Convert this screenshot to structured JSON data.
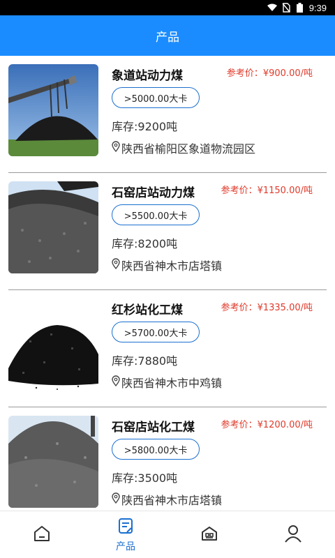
{
  "status": {
    "time": "9:39"
  },
  "header": {
    "title": "产品"
  },
  "products": [
    {
      "name": "象道站动力煤",
      "price": "参考价：¥900.00/吨",
      "calorific": ">5000.00大卡",
      "stock": "库存:9200吨",
      "location": "陕西省榆阳区象道物流园区",
      "image": "coal-conveyor-photo"
    },
    {
      "name": "石窑店站动力煤",
      "price": "参考价：¥1150.00/吨",
      "calorific": ">5500.00大卡",
      "stock": "库存:8200吨",
      "location": "陕西省神木市店塔镇",
      "image": "coal-pile-photo"
    },
    {
      "name": "红杉站化工煤",
      "price": "参考价：¥1335.00/吨",
      "calorific": ">5700.00大卡",
      "stock": "库存:7880吨",
      "location": "陕西省神木市中鸡镇",
      "image": "black-coal-heap-photo"
    },
    {
      "name": "石窑店站化工煤",
      "price": "参考价：¥1200.00/吨",
      "calorific": ">5800.00大卡",
      "stock": "库存:3500吨",
      "location": "陕西省神木市店塔镇",
      "image": "coal-stockyard-photo"
    }
  ],
  "tabbar": {
    "tabs": [
      {
        "label": "",
        "icon": "home-icon"
      },
      {
        "label": "产品",
        "icon": "product-doc-icon"
      },
      {
        "label": "",
        "icon": "store-icon"
      },
      {
        "label": "",
        "icon": "user-icon"
      }
    ]
  },
  "colors": {
    "accent": "#1a8cff",
    "price": "#e03a2a",
    "active_tab": "#1a6fd0"
  }
}
